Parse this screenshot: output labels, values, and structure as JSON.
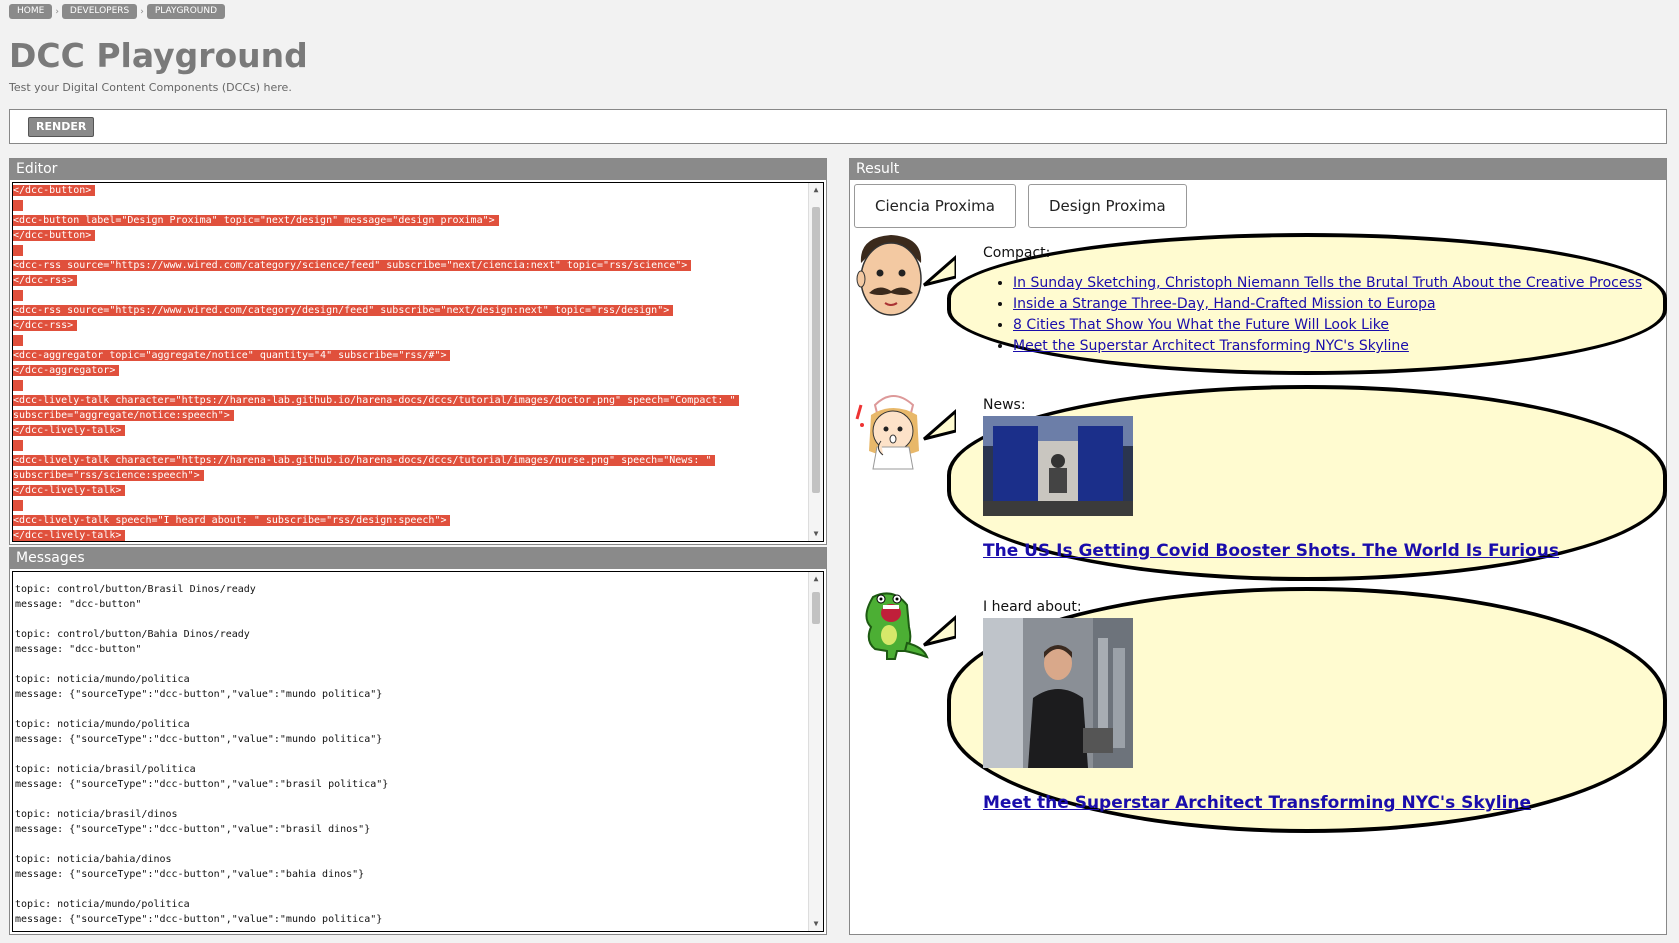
{
  "breadcrumb": [
    "HOME",
    "DEVELOPERS",
    "PLAYGROUND"
  ],
  "page": {
    "title": "DCC Playground",
    "subtitle": "Test your Digital Content Components (DCCs) here."
  },
  "toolbar": {
    "render_label": "RENDER"
  },
  "editor": {
    "header": "Editor",
    "lines": [
      "</dcc-button>",
      "",
      "<dcc-button label=\"Design Proxima\" topic=\"next/design\" message=\"design proxima\">",
      "</dcc-button>",
      "",
      "<dcc-rss source=\"https://www.wired.com/category/science/feed\" subscribe=\"next/ciencia:next\" topic=\"rss/science\">",
      "</dcc-rss>",
      "",
      "<dcc-rss source=\"https://www.wired.com/category/design/feed\" subscribe=\"next/design:next\" topic=\"rss/design\">",
      "</dcc-rss>",
      "",
      "<dcc-aggregator topic=\"aggregate/notice\" quantity=\"4\" subscribe=\"rss/#\">",
      "</dcc-aggregator>",
      "",
      "<dcc-lively-talk character=\"https://harena-lab.github.io/harena-docs/dccs/tutorial/images/doctor.png\" speech=\"Compact: \"",
      "subscribe=\"aggregate/notice:speech\">",
      "</dcc-lively-talk>",
      "",
      "<dcc-lively-talk character=\"https://harena-lab.github.io/harena-docs/dccs/tutorial/images/nurse.png\" speech=\"News: \"",
      "subscribe=\"rss/science:speech\">",
      "</dcc-lively-talk>",
      "",
      "<dcc-lively-talk speech=\"I heard about: \" subscribe=\"rss/design:speech\">",
      "</dcc-lively-talk>"
    ]
  },
  "messages": {
    "header": "Messages",
    "entries": [
      {
        "topic": "topic: control/button/Brasil Dinos/ready",
        "message": "message: \"dcc-button\""
      },
      {
        "topic": "topic: control/button/Bahia Dinos/ready",
        "message": "message: \"dcc-button\""
      },
      {
        "topic": "topic: noticia/mundo/politica",
        "message": "message: {\"sourceType\":\"dcc-button\",\"value\":\"mundo politica\"}"
      },
      {
        "topic": "topic: noticia/mundo/politica",
        "message": "message: {\"sourceType\":\"dcc-button\",\"value\":\"mundo politica\"}"
      },
      {
        "topic": "topic: noticia/brasil/politica",
        "message": "message: {\"sourceType\":\"dcc-button\",\"value\":\"brasil politica\"}"
      },
      {
        "topic": "topic: noticia/brasil/dinos",
        "message": "message: {\"sourceType\":\"dcc-button\",\"value\":\"brasil dinos\"}"
      },
      {
        "topic": "topic: noticia/bahia/dinos",
        "message": "message: {\"sourceType\":\"dcc-button\",\"value\":\"bahia dinos\"}"
      },
      {
        "topic": "topic: noticia/mundo/politica",
        "message": "message: {\"sourceType\":\"dcc-button\",\"value\":\"mundo politica\"}"
      }
    ]
  },
  "result": {
    "header": "Result",
    "buttons": [
      "Ciencia Proxima",
      "Design Proxima"
    ],
    "talks": [
      {
        "character": "doctor-icon",
        "speech": "Compact:",
        "links": [
          "In Sunday Sketching, Christoph Niemann Tells the Brutal Truth About the Creative Process",
          "Inside a Strange Three-Day, Hand-Crafted Mission to Europa",
          "8 Cities That Show You What the Future Will Look Like",
          "Meet the Superstar Architect Transforming NYC's Skyline"
        ]
      },
      {
        "character": "nurse-icon",
        "speech": "News:",
        "image": "vaccination-booth-photo",
        "headline": "The US Is Getting Covid Booster Shots. The World Is Furious"
      },
      {
        "character": "dinosaur-icon",
        "speech": "I heard about:",
        "image": "architect-portrait-photo",
        "headline": "Meet the Superstar Architect Transforming NYC's Skyline"
      }
    ]
  },
  "colors": {
    "code_highlight": "#e0503c",
    "header_bg": "#8a8a8a",
    "bubble_bg": "#fffbd0",
    "link": "#1a0dab"
  }
}
